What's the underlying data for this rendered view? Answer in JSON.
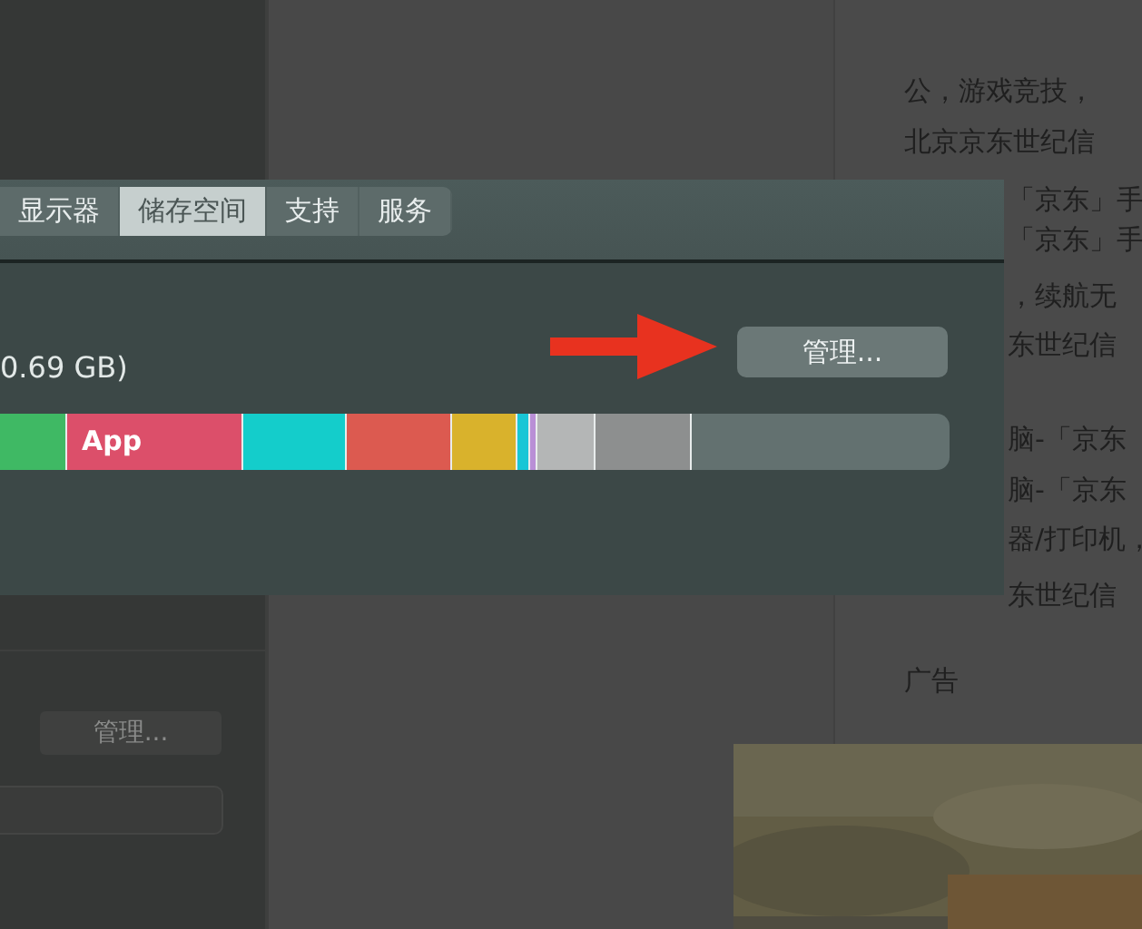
{
  "background_page": {
    "sidebar_button": "管理...",
    "article_lines": [
      "公，游戏竞技，",
      "北京京东世纪信",
      "「京东」手",
      "「京东」手",
      "，续航无",
      "东世纪信",
      "脑-「京东",
      "脑-「京东",
      "器/打印机，",
      "东世纪信"
    ],
    "ad_label": "广告"
  },
  "window": {
    "tabs": [
      {
        "label": "显示器",
        "selected": false
      },
      {
        "label": "储存空间",
        "selected": true
      },
      {
        "label": "支持",
        "selected": false
      },
      {
        "label": "服务",
        "selected": false
      }
    ],
    "storage_text": "0.69 GB)",
    "manage_button": "管理...",
    "storage_bar": {
      "segments": [
        {
          "color": "#3fb964"
        },
        {
          "label": "App",
          "color": "#dc4f6a"
        },
        {
          "color": "#14cdcb"
        },
        {
          "color": "#dc5a50"
        },
        {
          "color": "#d9b22c"
        },
        {
          "color": "#18c6d6"
        },
        {
          "color": "#b98fd6"
        },
        {
          "color": "#b4b6b6"
        },
        {
          "color": "#8d8f8f"
        }
      ]
    }
  }
}
